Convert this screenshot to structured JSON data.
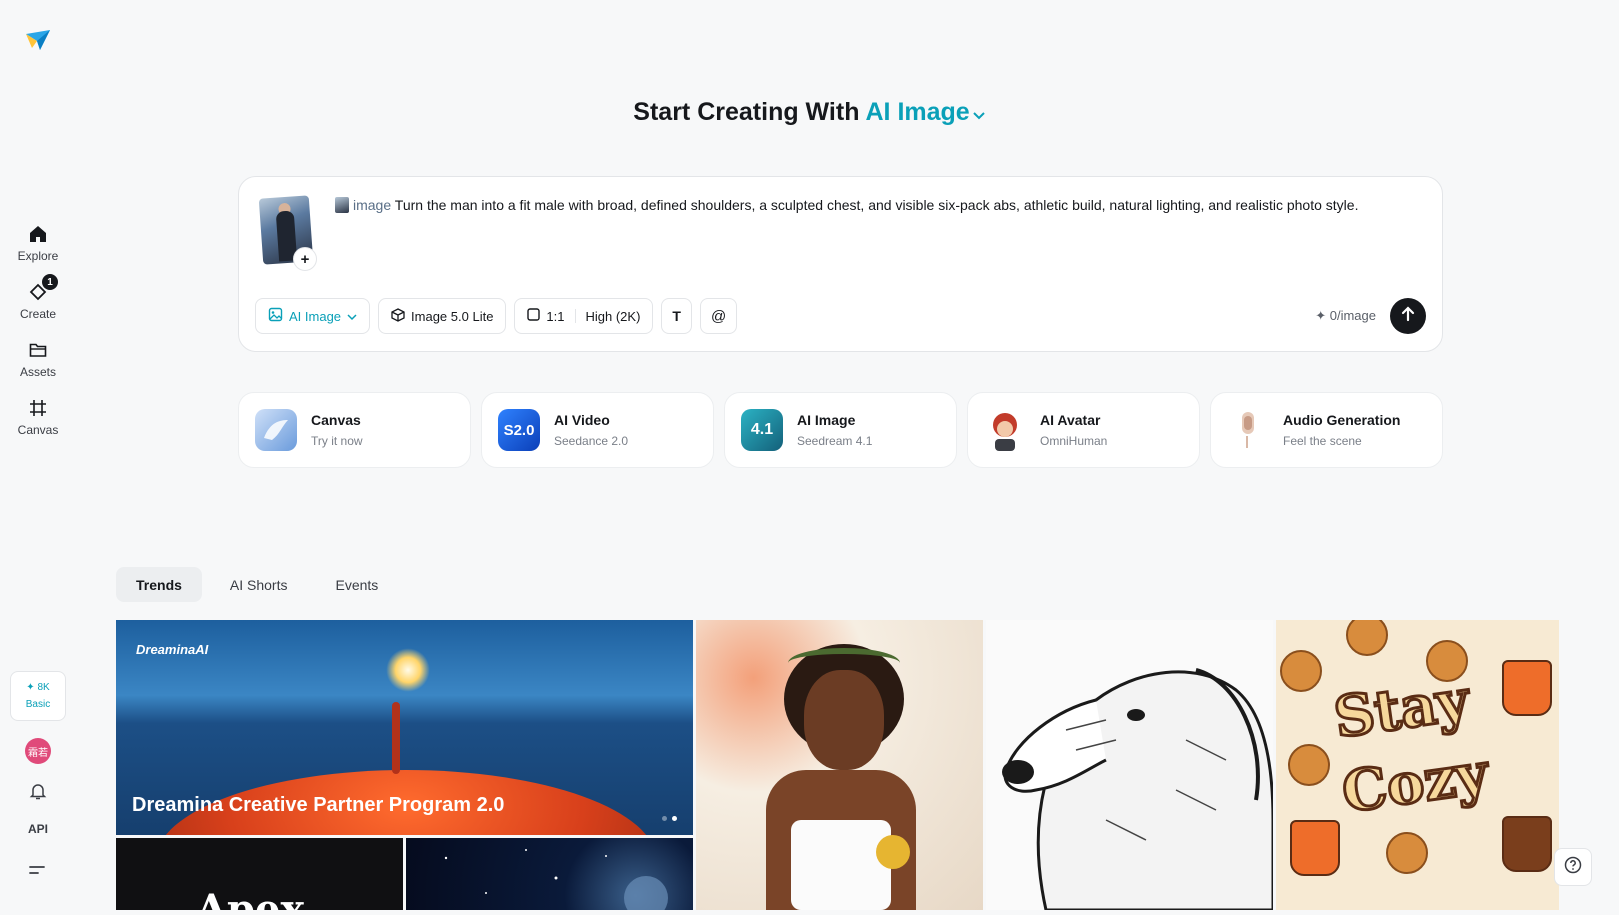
{
  "sidebar": {
    "items": [
      {
        "label": "Explore",
        "icon": "home-icon"
      },
      {
        "label": "Create",
        "icon": "create-diamond-icon",
        "badge": "1"
      },
      {
        "label": "Assets",
        "icon": "folder-icon"
      },
      {
        "label": "Canvas",
        "icon": "crop-icon"
      }
    ],
    "credits": {
      "amount": "✦ 8K",
      "plan": "Basic"
    },
    "avatar_text": "霜若",
    "api_label": "API"
  },
  "headline": {
    "prefix": "Start Creating With",
    "mode": "AI Image"
  },
  "prompt": {
    "tag": "image",
    "text": "Turn the man into a fit male with broad, defined shoulders, a sculpted chest, and visible six-pack abs, athletic build, natural lighting, and realistic photo style.",
    "add_label": "+"
  },
  "toolbar": {
    "mode_label": "AI Image",
    "model_label": "Image 5.0 Lite",
    "ratio_label": "1:1",
    "quality_label": "High (2K)",
    "text_icon_label": "T",
    "mention_label": "@",
    "cost_label": "✦ 0/image"
  },
  "tools": [
    {
      "name": "Canvas",
      "sub": "Try it now",
      "icon_text": "",
      "color": "#8fb3e8"
    },
    {
      "name": "AI Video",
      "sub": "Seedance 2.0",
      "icon_text": "S2.0",
      "color": "#1f6ee8"
    },
    {
      "name": "AI Image",
      "sub": "Seedream 4.1",
      "icon_text": "4.1",
      "color": "#1c8aa0"
    },
    {
      "name": "AI Avatar",
      "sub": "OmniHuman",
      "icon_text": "",
      "color": "#c23b2a"
    },
    {
      "name": "Audio Generation",
      "sub": "Feel the scene",
      "icon_text": "",
      "color": "#e9d6c8"
    }
  ],
  "tabs": [
    "Trends",
    "AI Shorts",
    "Events"
  ],
  "gallery": {
    "banner_brand": "DreaminaAI",
    "banner_title": "Dreamina Creative Partner Program 2.0",
    "apex_text": "Apex",
    "cozy_line1": "Stay",
    "cozy_line2": "Cozy"
  },
  "colors": {
    "accent": "#0aa0b8",
    "dark": "#16181c",
    "background": "#f7f8f9"
  }
}
